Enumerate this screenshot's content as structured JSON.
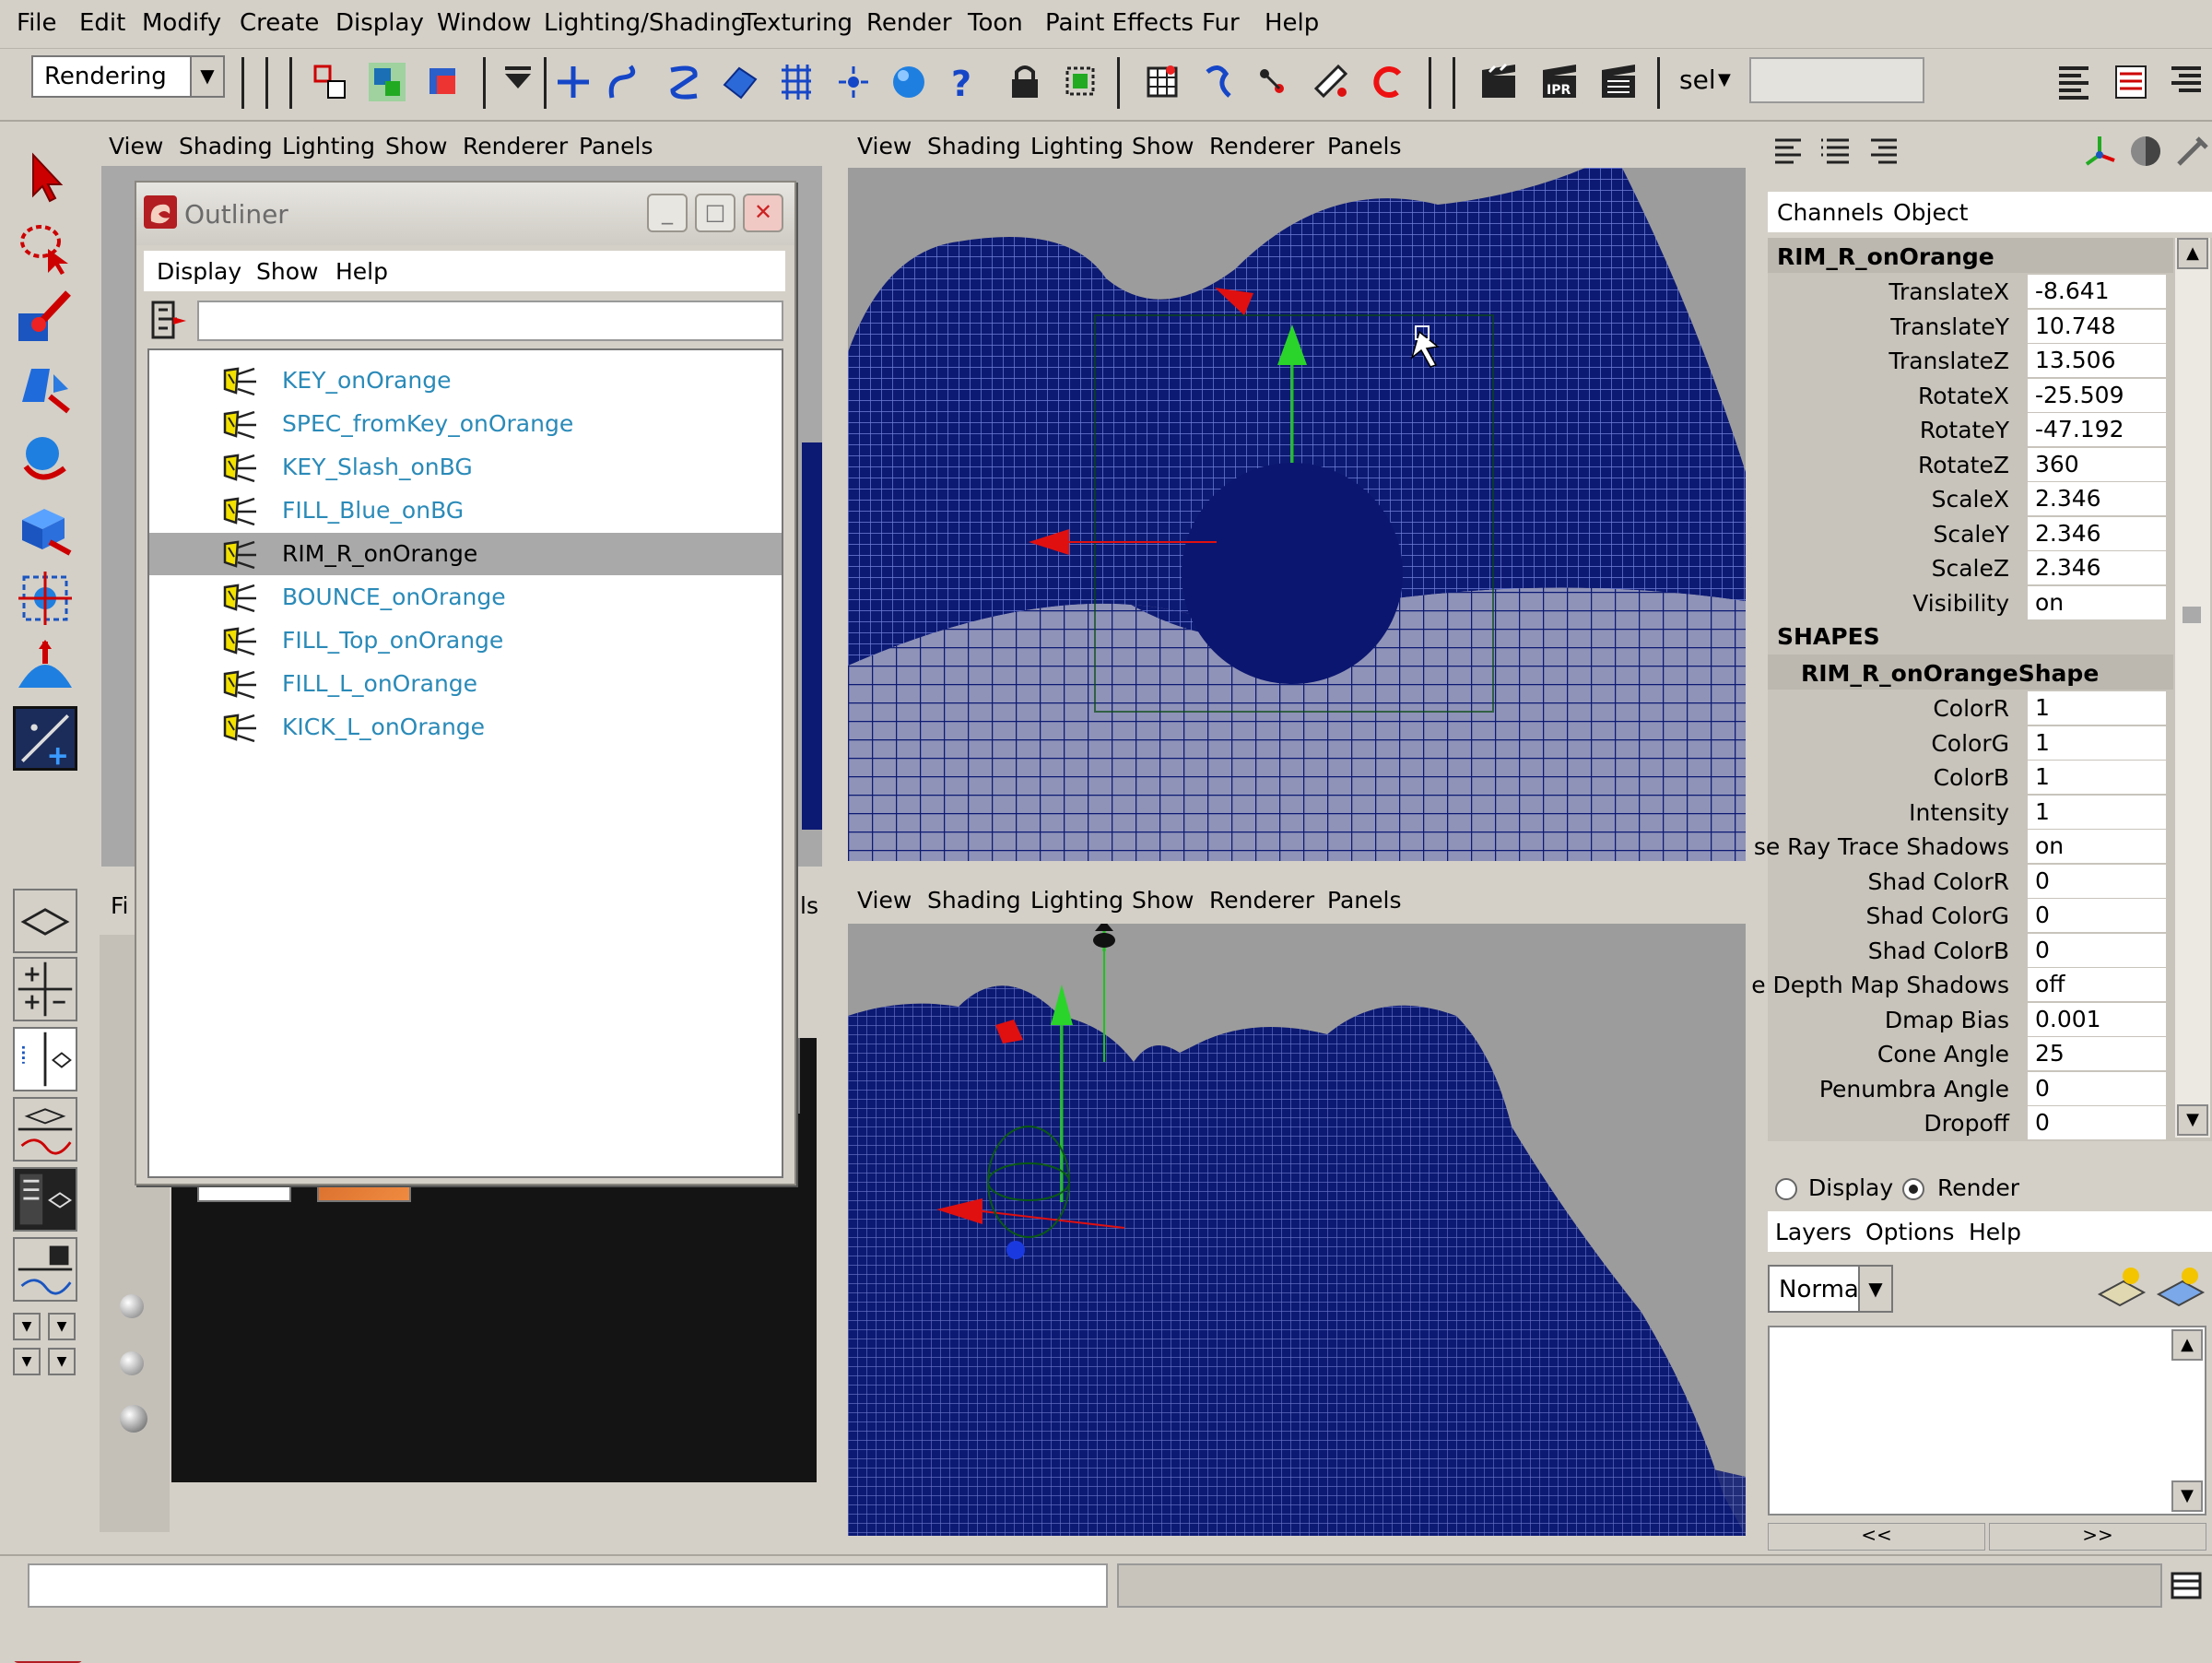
{
  "menubar": {
    "items": [
      "File",
      "Edit",
      "Modify",
      "Create",
      "Display",
      "Window",
      "Lighting/Shading",
      "Texturing",
      "Render",
      "Toon",
      "Paint Effects",
      "Fur",
      "Help"
    ]
  },
  "toolbar": {
    "menuset": "Rendering",
    "sel_label": "sel"
  },
  "viewports": {
    "top_left_menu": [
      "View",
      "Shading",
      "Lighting",
      "Show",
      "Renderer",
      "Panels"
    ],
    "top_right_menu": [
      "View",
      "Shading",
      "Lighting",
      "Show",
      "Renderer",
      "Panels"
    ],
    "bottom_right_menu": [
      "View",
      "Shading",
      "Lighting",
      "Show",
      "Renderer",
      "Panels"
    ],
    "bottom_left_fragment": "Fi",
    "bottom_left_right_fragment": "ls"
  },
  "outliner": {
    "title": "Outliner",
    "menu": [
      "Display",
      "Show",
      "Help"
    ],
    "items": [
      {
        "label": "KEY_onOrange",
        "selected": false
      },
      {
        "label": "SPEC_fromKey_onOrange",
        "selected": false
      },
      {
        "label": "KEY_Slash_onBG",
        "selected": false
      },
      {
        "label": "FILL_Blue_onBG",
        "selected": false
      },
      {
        "label": "RIM_R_onOrange",
        "selected": true
      },
      {
        "label": "BOUNCE_onOrange",
        "selected": false
      },
      {
        "label": "FILL_Top_onOrange",
        "selected": false
      },
      {
        "label": "FILL_L_onOrange",
        "selected": false
      },
      {
        "label": "KICK_L_onOrange",
        "selected": false
      }
    ]
  },
  "channel_box": {
    "tabs": [
      "Channels",
      "Object"
    ],
    "object_name": "RIM_R_onOrange",
    "channels": [
      {
        "name": "TranslateX",
        "value": "-8.641"
      },
      {
        "name": "TranslateY",
        "value": "10.748"
      },
      {
        "name": "TranslateZ",
        "value": "13.506"
      },
      {
        "name": "RotateX",
        "value": "-25.509"
      },
      {
        "name": "RotateY",
        "value": "-47.192"
      },
      {
        "name": "RotateZ",
        "value": "360"
      },
      {
        "name": "ScaleX",
        "value": "2.346"
      },
      {
        "name": "ScaleY",
        "value": "2.346"
      },
      {
        "name": "ScaleZ",
        "value": "2.346"
      },
      {
        "name": "Visibility",
        "value": "on"
      }
    ],
    "shapes_heading": "SHAPES",
    "shape_name": "RIM_R_onOrangeShape",
    "shape_channels": [
      {
        "name": "ColorR",
        "value": "1"
      },
      {
        "name": "ColorG",
        "value": "1"
      },
      {
        "name": "ColorB",
        "value": "1"
      },
      {
        "name": "Intensity",
        "value": "1"
      },
      {
        "name": "se Ray Trace Shadows",
        "value": "on"
      },
      {
        "name": "Shad ColorR",
        "value": "0"
      },
      {
        "name": "Shad ColorG",
        "value": "0"
      },
      {
        "name": "Shad ColorB",
        "value": "0"
      },
      {
        "name": "e Depth Map Shadows",
        "value": "off"
      },
      {
        "name": "Dmap Bias",
        "value": "0.001"
      },
      {
        "name": "Cone Angle",
        "value": "25"
      },
      {
        "name": "Penumbra Angle",
        "value": "0"
      },
      {
        "name": "Dropoff",
        "value": "0"
      }
    ]
  },
  "layer_editor": {
    "radio_display": "Display",
    "radio_render": "Render",
    "selected_radio": "Render",
    "menu": [
      "Layers",
      "Options",
      "Help"
    ],
    "blend_mode": "Normal",
    "nav_prev": "<<",
    "nav_next": ">>"
  },
  "colors": {
    "ui_gray": "#d4d0c8",
    "mesh_blue": "#0d1a73",
    "outliner_link": "#2a8ab8",
    "viewport_bg": "#9c9c9c"
  }
}
